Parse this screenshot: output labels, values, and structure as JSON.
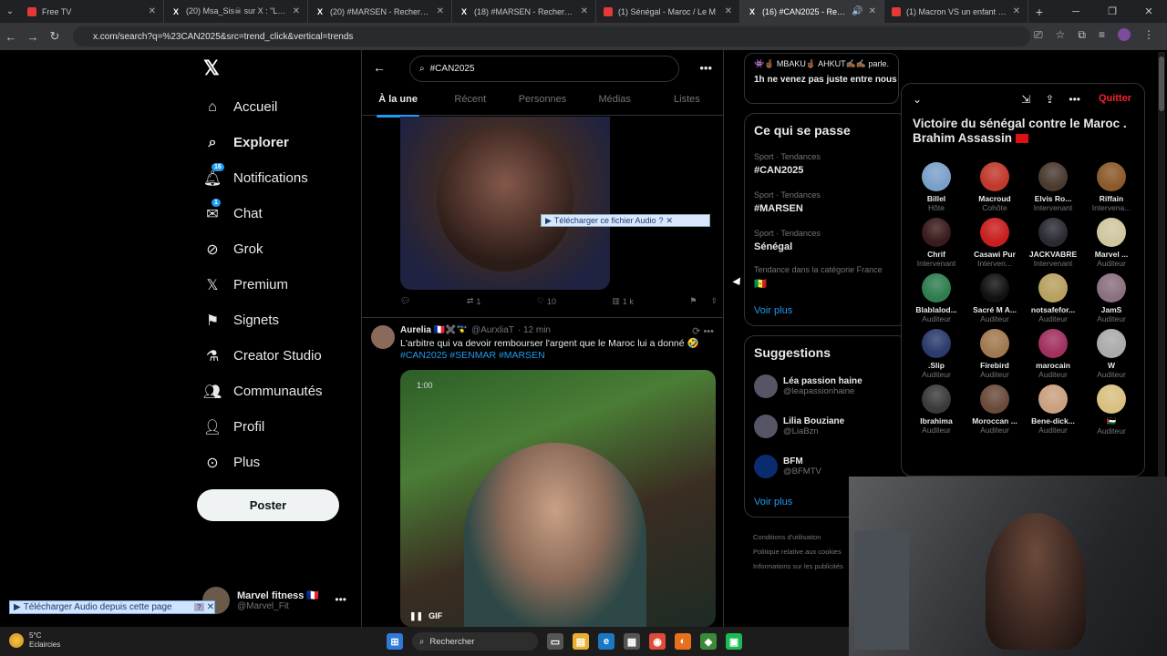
{
  "browser": {
    "tabs": [
      {
        "title": "Free TV",
        "active": false
      },
      {
        "title": "(20) Msa_Sis☠ sur X : \"L'arbitre",
        "active": false
      },
      {
        "title": "(20) #MARSEN - Recherche / X",
        "active": false
      },
      {
        "title": "(18) #MARSEN - Recherche / X",
        "active": false
      },
      {
        "title": "(1) Sénégal - Maroc / Le M",
        "active": false
      },
      {
        "title": "(16) #CAN2025 - Recherche",
        "active": true
      },
      {
        "title": "(1) Macron VS un enfant - \"Il e",
        "active": false
      }
    ],
    "url": "x.com/search?q=%23CAN2025&src=trend_click&vertical=trends"
  },
  "nav": {
    "items": [
      {
        "label": "Accueil",
        "icon": "home-icon"
      },
      {
        "label": "Explorer",
        "icon": "search-icon"
      },
      {
        "label": "Notifications",
        "icon": "bell-icon",
        "badge": "16"
      },
      {
        "label": "Chat",
        "icon": "mail-icon",
        "badge": "1"
      },
      {
        "label": "Grok",
        "icon": "grok-icon"
      },
      {
        "label": "Premium",
        "icon": "x-icon"
      },
      {
        "label": "Signets",
        "icon": "bookmark-icon"
      },
      {
        "label": "Creator Studio",
        "icon": "flask-icon"
      },
      {
        "label": "Communautés",
        "icon": "people-icon"
      },
      {
        "label": "Profil",
        "icon": "person-icon"
      },
      {
        "label": "Plus",
        "icon": "more-circle-icon"
      }
    ],
    "post_label": "Poster"
  },
  "profile": {
    "name": "Marvel fitness 🇫🇷",
    "handle": "@Marvel_Fit"
  },
  "download_page_bar": "Télécharger Audio depuis cette page",
  "download_audio_bar": "Télécharger ce fichier Audio",
  "search": {
    "value": "#CAN2025"
  },
  "tabs": [
    "À la une",
    "Récent",
    "Personnes",
    "Médias",
    "Listes"
  ],
  "tweet1": {
    "reply": "",
    "retweets": "1",
    "likes": "10",
    "views": "1 k"
  },
  "tweet2": {
    "name": "Aurelia 🇫🇷✖️🇬🇵",
    "handle": "@AurxliaT",
    "time": "· 12 min",
    "text": "L'arbitre qui va devoir rembourser l'argent que le Maroc lui a donné 🤣",
    "hashtags": "#CAN2025 #SENMAR #MARSEN",
    "video_time": "1:00",
    "gif_label": "GIF"
  },
  "right_card": {
    "line1": "👾🤞🏾 MBAKU🤞🏾 AHKUT✍🏾✍🏾 parle.",
    "line2": "1h ne venez pas juste entre nous"
  },
  "trends": {
    "title": "Ce qui se passe",
    "items": [
      {
        "category": "Sport · Tendances",
        "name": "#CAN2025"
      },
      {
        "category": "Sport · Tendances",
        "name": "#MARSEN"
      },
      {
        "category": "Sport · Tendances",
        "name": "Sénégal"
      },
      {
        "category": "Tendance dans la catégorie France",
        "name": "🇸🇳"
      }
    ],
    "more": "Voir plus"
  },
  "suggestions": {
    "title": "Suggestions",
    "items": [
      {
        "name": "Léa passion haine",
        "handle": "@leapassionhaine"
      },
      {
        "name": "Lilia Bouziane",
        "handle": "@LiaBzn"
      },
      {
        "name": "BFM",
        "handle": "@BFMTV"
      }
    ],
    "more": "Voir plus"
  },
  "footer": [
    "Conditions d'utilisation",
    "Politique relative aux cookies",
    "Informations sur les publicités"
  ],
  "space": {
    "quit": "Quitter",
    "title": "Victoire du sénégal contre le Maroc . Brahim Assassin",
    "participants": [
      {
        "name": "Billel",
        "role": "Hôte",
        "color": "#7aa0c8"
      },
      {
        "name": "Macroud",
        "role": "Cohôte",
        "color": "#c0392b"
      },
      {
        "name": "Elvis Ro...",
        "role": "Intervenant",
        "color": "#4a3a30"
      },
      {
        "name": "Riffain",
        "role": "Intervena...",
        "color": "#8a5a2a"
      },
      {
        "name": "Chrif",
        "role": "Intervenant",
        "color": "#3a1a1a"
      },
      {
        "name": "Casawi Pur",
        "role": "Interven...",
        "color": "#c81e1e"
      },
      {
        "name": "JACKVABRE",
        "role": "Intervenant",
        "color": "#2a2a33"
      },
      {
        "name": "Marvel ...",
        "role": "Auditeur",
        "color": "#cfc6a0"
      },
      {
        "name": "Blablalod...",
        "role": "Auditeur",
        "color": "#2e7d4f"
      },
      {
        "name": "Sacré M A...",
        "role": "Auditeur",
        "color": "#111111"
      },
      {
        "name": "notsafefor...",
        "role": "Auditeur",
        "color": "#b8a060"
      },
      {
        "name": "JamS",
        "role": "Auditeur",
        "color": "#8a7080"
      },
      {
        "name": ".Slip",
        "role": "Auditeur",
        "color": "#2a3a6a"
      },
      {
        "name": "Firebird",
        "role": "Auditeur",
        "color": "#a07850"
      },
      {
        "name": "marocain",
        "role": "Auditeur",
        "color": "#a03060"
      },
      {
        "name": "W",
        "role": "Auditeur",
        "color": "#aaaaaa"
      },
      {
        "name": "Ibrahima",
        "role": "Auditeur",
        "color": "#3a3a3a"
      },
      {
        "name": "Moroccan ...",
        "role": "Auditeur",
        "color": "#6a4a3a"
      },
      {
        "name": "Bene-dick...",
        "role": "Auditeur",
        "color": "#c8a080"
      },
      {
        "name": "🇵🇸",
        "role": "Auditeur",
        "color": "#d8c080"
      }
    ]
  },
  "taskbar": {
    "temp": "5°C",
    "weather": "Eclaircies",
    "search": "Rechercher"
  }
}
